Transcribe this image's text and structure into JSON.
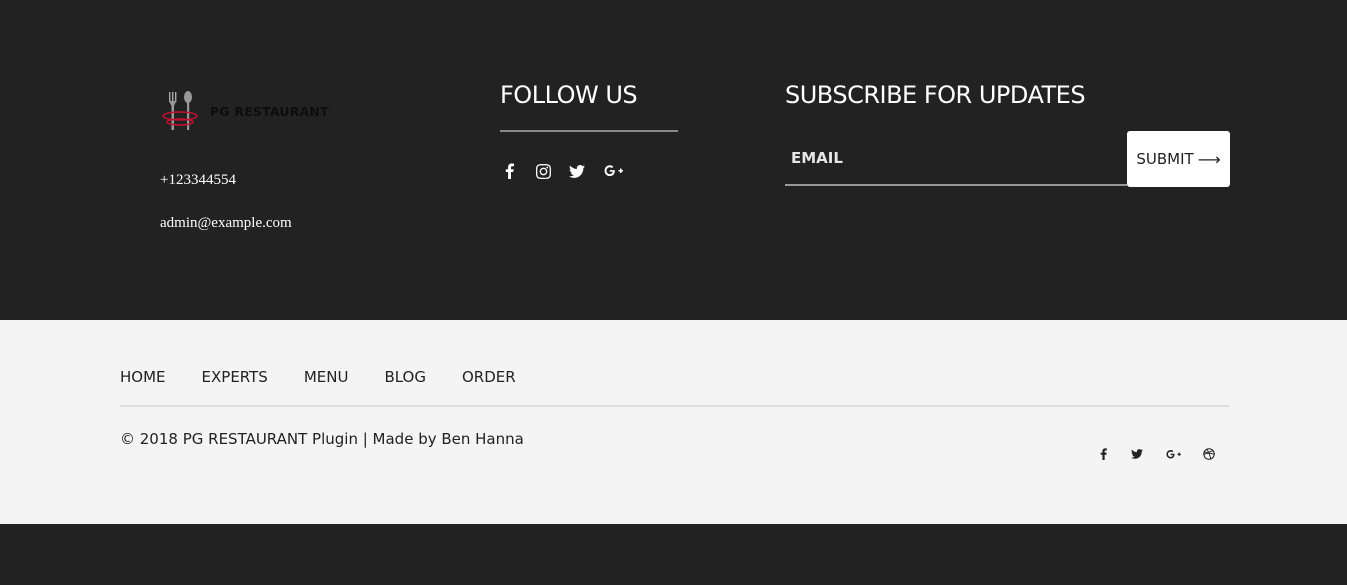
{
  "brand": {
    "logo_text": "PG RESTAURANT"
  },
  "contact": {
    "phone": "+123344554",
    "email": "admin@example.com"
  },
  "follow": {
    "title": "FOLLOW US",
    "icons": [
      "facebook-icon",
      "instagram-icon",
      "twitter-icon",
      "google-plus-icon"
    ]
  },
  "subscribe": {
    "title": "SUBSCRIBE FOR UPDATES",
    "email_placeholder": "EMAIL",
    "email_value": "",
    "submit_label": "SUBMIT",
    "submit_arrow": "⟶"
  },
  "nav": {
    "items": [
      {
        "label": "HOME"
      },
      {
        "label": "EXPERTS"
      },
      {
        "label": "MENU"
      },
      {
        "label": "BLOG"
      },
      {
        "label": "ORDER"
      }
    ]
  },
  "footer": {
    "copyright": "© 2018 PG RESTAURANT Plugin | Made by Ben Hanna",
    "social_icons": [
      "facebook-icon",
      "twitter-icon",
      "google-plus-icon",
      "dribbble-icon"
    ]
  },
  "colors": {
    "dark_bg": "#222222",
    "light_bg": "#f4f4f4",
    "logo_red": "#c8102e"
  }
}
